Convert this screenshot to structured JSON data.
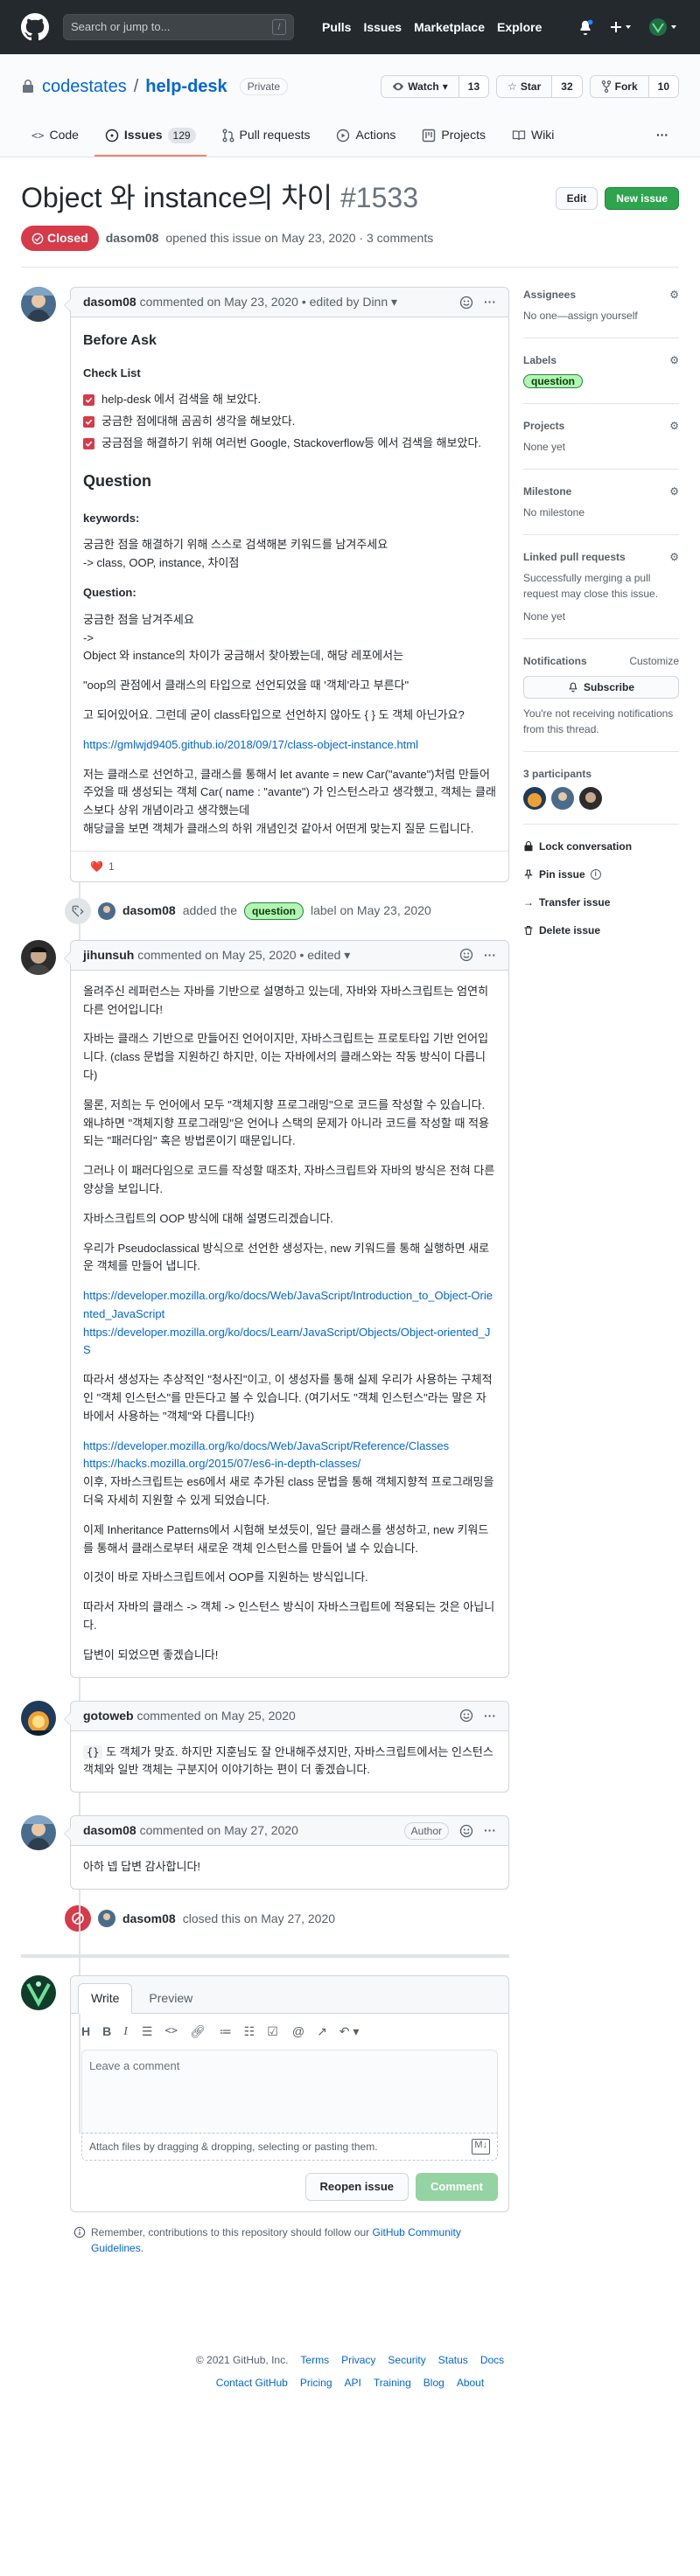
{
  "header": {
    "search_placeholder": "Search or jump to...",
    "search_key": "/",
    "nav": [
      "Pulls",
      "Issues",
      "Marketplace",
      "Explore"
    ]
  },
  "repo": {
    "owner": "codestates",
    "separator": "/",
    "name": "help-desk",
    "visibility": "Private",
    "watch_label": "Watch",
    "watch_count": "13",
    "star_label": "Star",
    "star_count": "32",
    "fork_label": "Fork",
    "fork_count": "10",
    "tabs": [
      {
        "label": "Code",
        "count": ""
      },
      {
        "label": "Issues",
        "count": "129"
      },
      {
        "label": "Pull requests",
        "count": ""
      },
      {
        "label": "Actions",
        "count": ""
      },
      {
        "label": "Projects",
        "count": ""
      },
      {
        "label": "Wiki",
        "count": ""
      }
    ]
  },
  "issue": {
    "title": "Object 와 instance의 차이",
    "number": "#1533",
    "edit_label": "Edit",
    "new_issue_label": "New issue",
    "state": "Closed",
    "author": "dasom08",
    "meta": "opened this issue on May 23, 2020 · 3 comments"
  },
  "comments": [
    {
      "author": "dasom08",
      "meta": "commented on May 23, 2020",
      "edited": "• edited by Dinn",
      "before_ask": "Before Ask",
      "checklist_title": "Check List",
      "checklist": [
        "help-desk 에서 검색을 해 보았다.",
        "궁금한 점에대해 곰곰히 생각을 해보았다.",
        "궁금점을 해결하기 위해 여러번 Google, Stackoverflow등 에서 검색을 해보았다."
      ],
      "question_heading": "Question",
      "keywords_label": "keywords:",
      "keywords_line1": "궁금한 점을 해결하기 위해 스스로 검색해본 키워드를 남겨주세요",
      "keywords_line2": "-> class, OOP, instance, 차이점",
      "question_label": "Question:",
      "q_line1": "궁금한 점을 남겨주세요",
      "q_line2": "->",
      "q_line3": "Object 와 instance의 차이가 궁금해서 찾아봤는데, 해당 레포에서는",
      "q_quote": "\"oop의 관점에서 클래스의 타입으로 선언되었을 때 '객체'라고 부른다\"",
      "q_line4": "고 되어있어요. 그런데 굳이 class타입으로 선언하지 않아도 { } 도 객체 아닌가요?",
      "q_link": "https://gmlwjd9405.github.io/2018/09/17/class-object-instance.html",
      "q_para": "저는 클래스로 선언하고, 클래스를 통해서 let avante = new Car(\"avante\")처럼 만들어 주었을 때 생성되는 객체 Car( name : \"avante\") 가 인스턴스라고 생각했고, 객체는 클래스보다 상위 개념이라고 생각했는데",
      "q_para2": "해당글을 보면 객체가 클래스의 하위 개념인것 같아서 어떤게 맞는지 질문 드립니다.",
      "reaction_emoji": "❤️",
      "reaction_count": "1"
    },
    {
      "author": "jihunsuh",
      "meta": "commented on May 25, 2020",
      "edited": "• edited",
      "paragraphs": [
        "올려주신 레퍼런스는 자바를 기반으로 설명하고 있는데, 자바와 자바스크립트는 엄연히 다른 언어입니다!",
        "자바는 클래스 기반으로 만들어진 언어이지만, 자바스크립트는 프로토타입 기반 언어입니다. (class 문법을 지원하긴 하지만, 이는 자바에서의 클래스와는 작동 방식이 다릅니다)",
        "물론, 저희는 두 언어에서 모두 \"객체지향 프로그래밍\"으로 코드를 작성할 수 있습니다. 왜냐하면 \"객체지향 프로그래밍\"은 언어나 스택의 문제가 아니라 코드를 작성할 때 적용되는 \"패러다임\" 혹은 방법론이기 때문입니다.",
        "그러나 이 패러다임으로 코드를 작성할 때조차, 자바스크립트와 자바의 방식은 전혀 다른 양상을 보입니다.",
        "자바스크립트의 OOP 방식에 대해 설명드리겠습니다.",
        "우리가 Pseudoclassical 방식으로 선언한 생성자는, new 키워드를 통해 실행하면 새로운 객체를 만들어 냅니다."
      ],
      "links1": [
        "https://developer.mozilla.org/ko/docs/Web/JavaScript/Introduction_to_Object-Oriented_JavaScript",
        "https://developer.mozilla.org/ko/docs/Learn/JavaScript/Objects/Object-oriented_JS"
      ],
      "para_after_links": "따라서 생성자는 추상적인 \"청사진\"이고, 이 생성자를 통해 실제 우리가 사용하는 구체적인 \"객체 인스턴스\"를 만든다고 볼 수 있습니다. (여기서도 \"객체 인스턴스\"라는 말은 자바에서 사용하는 \"객체\"와 다릅니다!)",
      "links2": [
        "https://developer.mozilla.org/ko/docs/Web/JavaScript/Reference/Classes",
        "https://hacks.mozilla.org/2015/07/es6-in-depth-classes/"
      ],
      "para_after_links2": "이후, 자바스크립트는 es6에서 새로 추가된 class 문법을 통해 객체지향적 프로그래밍을 더욱 자세히 지원할 수 있게 되었습니다.",
      "tail": [
        "이제 Inheritance Patterns에서 시험해 보셨듯이, 일단 클래스를 생성하고, new 키워드를 통해서 클래스로부터 새로운 객체 인스턴스를 만들어 낼 수 있습니다.",
        "이것이 바로 자바스크립트에서 OOP를 지원하는 방식입니다.",
        "따라서 자바의 클래스 -> 객체 -> 인스턴스 방식이 자바스크립트에 적용되는 것은 아닙니다.",
        "답변이 되었으면 좋겠습니다!"
      ]
    },
    {
      "author": "gotoweb",
      "meta": "commented on May 25, 2020",
      "code": "{}",
      "text": " 도 객체가 맞죠. 하지만 지훈님도 잘 안내해주셨지만, 자바스크립트에서는 인스턴스 객체와 일반 객체는 구분지어 이야기하는 편이 더 좋겠습니다."
    },
    {
      "author": "dasom08",
      "meta": "commented on May 27, 2020",
      "badge": "Author",
      "text": "아하 넵 답변 감사합니다!"
    }
  ],
  "events": {
    "labeled_author": "dasom08",
    "labeled_pre": "added the",
    "labeled_label": "question",
    "labeled_post": "label on May 23, 2020",
    "closed_author": "dasom08",
    "closed_text": "closed this on May 27, 2020"
  },
  "sidebar": {
    "assignees_title": "Assignees",
    "assignees_value": "No one—assign yourself",
    "labels_title": "Labels",
    "label": "question",
    "projects_title": "Projects",
    "projects_value": "None yet",
    "milestone_title": "Milestone",
    "milestone_value": "No milestone",
    "linked_title": "Linked pull requests",
    "linked_desc": "Successfully merging a pull request may close this issue.",
    "linked_value": "None yet",
    "notifications_title": "Notifications",
    "customize": "Customize",
    "subscribe": "Subscribe",
    "notif_desc": "You're not receiving notifications from this thread.",
    "participants": "3 participants",
    "lock": "Lock conversation",
    "pin": "Pin issue",
    "transfer": "Transfer issue",
    "delete": "Delete issue"
  },
  "composer": {
    "write_tab": "Write",
    "preview_tab": "Preview",
    "placeholder": "Leave a comment",
    "attach": "Attach files by dragging & dropping, selecting or pasting them.",
    "reopen": "Reopen issue",
    "comment": "Comment",
    "remember_pre": "Remember, contributions to this repository should follow our",
    "remember_link": "GitHub Community Guidelines",
    "remember_post": "."
  },
  "footer": {
    "copyright": "© 2021 GitHub, Inc.",
    "row1": [
      "Terms",
      "Privacy",
      "Security",
      "Status",
      "Docs"
    ],
    "row2": [
      "Contact GitHub",
      "Pricing",
      "API",
      "Training",
      "Blog",
      "About"
    ]
  },
  "colors": {
    "header_bg": "#24292e",
    "closed": "#d73a49",
    "green": "#2ea44f",
    "link": "#0366d6",
    "label_bg": "#b3f5b3"
  }
}
